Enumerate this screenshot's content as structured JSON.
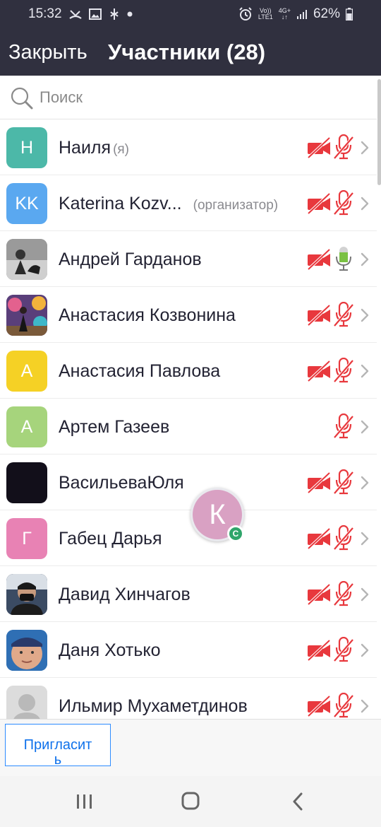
{
  "status_bar": {
    "time": "15:32",
    "volte": "Vo))",
    "lte": "LTE1",
    "network": "4G+",
    "battery": "62%"
  },
  "header": {
    "close_label": "Закрыть",
    "title": "Участники (28)"
  },
  "search": {
    "placeholder": "Поиск"
  },
  "participants": [
    {
      "name": "Наиля",
      "tag": "(я)",
      "initials": "Н",
      "avatar_color": "#4cb8a8",
      "camera": "off",
      "mic": "muted"
    },
    {
      "name": "Katerina Kozv...",
      "tag": "(организатор)",
      "initials": "KK",
      "avatar_color": "#5aa8f0",
      "camera": "off",
      "mic": "muted"
    },
    {
      "name": "Андрей Гарданов",
      "tag": "",
      "initials": "",
      "avatar_color": "#7c7c7c",
      "avatar_type": "photo-bw",
      "camera": "off",
      "mic": "active"
    },
    {
      "name": "Анастасия Козвонина",
      "tag": "",
      "initials": "",
      "avatar_color": "#6d4a8f",
      "avatar_type": "photo-colorful",
      "camera": "off",
      "mic": "muted"
    },
    {
      "name": "Анастасия Павлова",
      "tag": "",
      "initials": "А",
      "avatar_color": "#f5d125",
      "camera": "off",
      "mic": "muted"
    },
    {
      "name": "Артем Газеев",
      "tag": "",
      "initials": "А",
      "avatar_color": "#a6d47c",
      "camera": "none",
      "mic": "muted"
    },
    {
      "name": "ВасильеваЮля",
      "tag": "",
      "initials": "",
      "avatar_color": "#120f1a",
      "camera": "off",
      "mic": "muted"
    },
    {
      "name": "Габец Дарья",
      "tag": "",
      "initials": "Г",
      "avatar_color": "#e882b4",
      "camera": "off",
      "mic": "muted"
    },
    {
      "name": "Давид Хинчагов",
      "tag": "",
      "initials": "",
      "avatar_color": "#3b4b63",
      "avatar_type": "photo-mask",
      "camera": "off",
      "mic": "muted"
    },
    {
      "name": "Даня Хотько",
      "tag": "",
      "initials": "",
      "avatar_color": "#2f6fb4",
      "avatar_type": "photo-face",
      "camera": "off",
      "mic": "muted"
    },
    {
      "name": "Ильмир Мухаметдинов",
      "tag": "",
      "initials": "",
      "avatar_color": "#d7d7d7",
      "avatar_type": "default-silhouette",
      "camera": "off",
      "mic": "muted"
    }
  ],
  "floating_video": {
    "initial": "К",
    "badge": "C"
  },
  "bottom_bar": {
    "invite_label": "Пригласит\nь"
  },
  "colors": {
    "header_bg": "#30303f",
    "muted_red": "#e8383d",
    "mic_active_green": "#7ac143",
    "accent_blue": "#0e71eb"
  }
}
